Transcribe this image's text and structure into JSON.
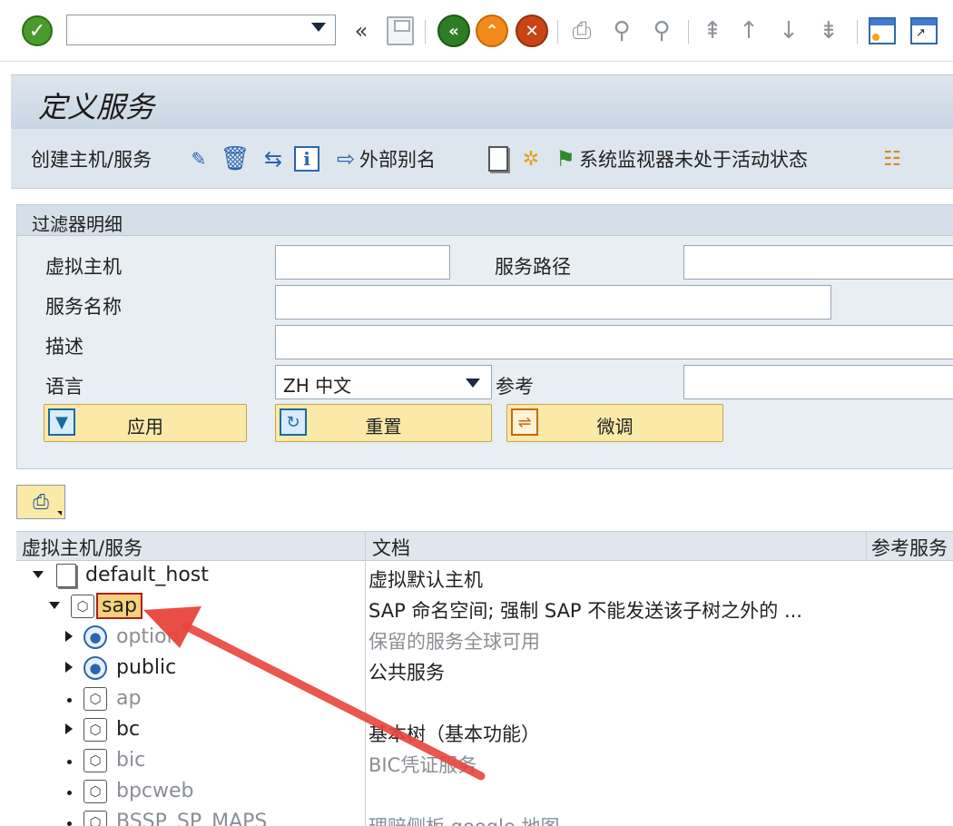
{
  "toolbar": {
    "command_field": {
      "value": "",
      "placeholder": ""
    },
    "icons": [
      "check-icon",
      "dropdown-icon",
      "double-chevron-left-icon",
      "save-icon",
      "back-icon",
      "exit-icon",
      "cancel-icon",
      "print-icon",
      "find-icon",
      "find-next-icon",
      "first-page-icon",
      "previous-page-icon",
      "next-page-icon",
      "last-page-icon",
      "new-session-icon",
      "shortcut-icon"
    ]
  },
  "page": {
    "title": "定义服务"
  },
  "app_toolbar": {
    "create_host_service": "创建主机/服务",
    "external_alias": "外部别名",
    "monitor_status": "系统监视器未处于活动状态"
  },
  "filter": {
    "title": "过滤器明细",
    "virtual_host_label": "虚拟主机",
    "virtual_host_value": "",
    "service_path_label": "服务路径",
    "service_path_value": "",
    "service_name_label": "服务名称",
    "service_name_value": "",
    "description_label": "描述",
    "description_value": "",
    "language_label": "语言",
    "language_value": "ZH 中文",
    "reference_label": "参考",
    "reference_value": "",
    "apply_label": "应用",
    "reset_label": "重置",
    "finetune_label": "微调"
  },
  "grid": {
    "headers": {
      "host_service": "虚拟主机/服务",
      "documentation": "文档",
      "reference_service": "参考服务"
    },
    "rows": [
      {
        "name": "default_host",
        "doc": "虚拟默认主机"
      },
      {
        "name": "sap",
        "doc": "SAP 命名空间; 强制 SAP 不能发送该子树之外的 ..."
      },
      {
        "name": "option",
        "doc": "保留的服务全球可用"
      },
      {
        "name": "public",
        "doc": "公共服务"
      },
      {
        "name": "ap",
        "doc": ""
      },
      {
        "name": "bc",
        "doc": "基本树（基本功能）"
      },
      {
        "name": "bic",
        "doc": "BIC凭证服务"
      },
      {
        "name": "bpcweb",
        "doc": ""
      },
      {
        "name": "BSSP_SP_MAPS",
        "doc": "理赔侧板 google 地图"
      }
    ]
  },
  "colors": {
    "accent_blue": "#2b64b0",
    "selection_yellow": "#f7d27a",
    "annotation_red": "#e8453c"
  }
}
